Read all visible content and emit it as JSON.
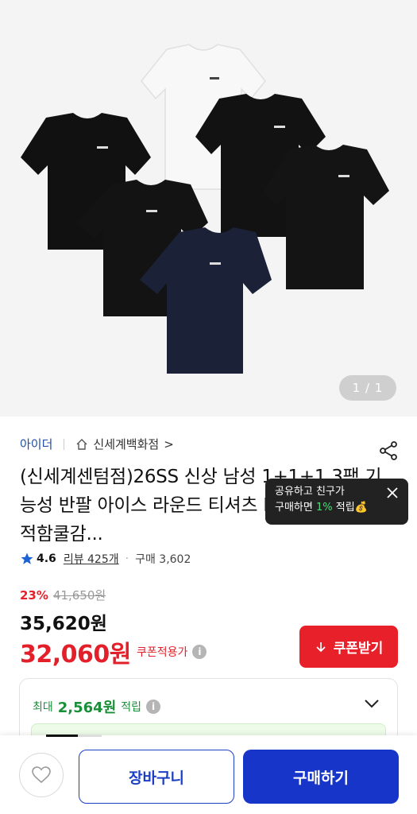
{
  "gallery": {
    "counter_text": "1 / 1"
  },
  "seller": {
    "brand": "아이더",
    "store": "신세계백화점",
    "store_chevron": ">"
  },
  "product": {
    "title": "(신세계센텀점)26SS 신상 남성 1+1+1 3팩 기능성 반팔 아이스 라운드 티셔츠 DMM26296/쾌적함쿨감..."
  },
  "tooltip": {
    "line1": "공유하고 친구가",
    "line2_prefix": "구매하면 ",
    "line2_highlight": "1%",
    "line2_suffix": " 적립",
    "emoji": "💰"
  },
  "rating": {
    "score": "4.6",
    "review_text": "리뷰 425개",
    "purchase_text": "구매 3,602"
  },
  "pricing": {
    "discount": "23%",
    "original_price": "41,650원",
    "price": "35,620원",
    "coupon_price": "32,060원",
    "coupon_label": "쿠폰적용가",
    "coupon_button": "쿠폰받기"
  },
  "points": {
    "prefix": "최대",
    "amount": "2,564원",
    "suffix": "적립"
  },
  "bottom": {
    "cart_label": "장바구니",
    "buy_label": "구매하기"
  },
  "colors": {
    "accent_red": "#e8202a",
    "brand_blue": "#1736c9",
    "points_green": "#1a8f3a"
  },
  "icons": [
    "share-icon",
    "home-icon",
    "star-icon",
    "info-icon",
    "download-icon",
    "chevron-down-icon",
    "heart-icon",
    "close-icon"
  ]
}
